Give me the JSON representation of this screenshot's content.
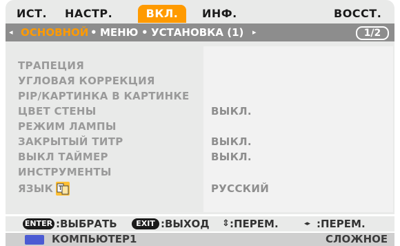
{
  "top_tabs": {
    "items": [
      {
        "label": "ИСТ."
      },
      {
        "label": "НАСТР."
      },
      {
        "label": "ВКЛ.",
        "active": true
      },
      {
        "label": "ИНФ."
      },
      {
        "label": "ВОССТ."
      }
    ]
  },
  "sub_tabs": {
    "items": [
      {
        "label": "ОСНОВНОЙ",
        "active": true
      },
      {
        "label": "МЕНЮ"
      },
      {
        "label": "УСТАНОВКА (1)"
      }
    ],
    "page_indicator": "1/2",
    "left_arrow": "◂",
    "right_arrow": "▸",
    "separator": "•"
  },
  "menu": {
    "rows": [
      {
        "label": "ТРАПЕЦИЯ",
        "value": ""
      },
      {
        "label": "УГЛОВАЯ КОРРЕКЦИЯ",
        "value": ""
      },
      {
        "label": "PIP/КАРТИНКА В КАРТИНКЕ",
        "value": ""
      },
      {
        "label": "ЦВЕТ СТЕНЫ",
        "value": "ВЫКЛ."
      },
      {
        "label": "РЕЖИМ ЛАМПЫ",
        "value": ""
      },
      {
        "label": "ЗАКРЫТЫЙ ТИТР",
        "value": "ВЫКЛ."
      },
      {
        "label": "ВЫКЛ ТАЙМЕР",
        "value": "ВЫКЛ."
      },
      {
        "label": "ИНСТРУМЕНТЫ",
        "value": ""
      },
      {
        "label": "ЯЗЫК",
        "value": "РУССКИЙ",
        "icon": "language-icon"
      }
    ]
  },
  "hints": {
    "enter_key": "ENTER",
    "enter_action": ":ВЫБРАТЬ",
    "exit_key": "EXIT",
    "exit_action": ":ВЫХОД",
    "updown_symbol": "⇕",
    "updown_action": ":ПЕРЕМ.",
    "leftright_symbol": "◂▸",
    "leftright_action": ":ПЕРЕМ."
  },
  "status": {
    "source_icon": "monitor-icon",
    "source": "КОМПЬЮТЕР1",
    "mode": "СЛОЖНОЕ"
  },
  "colors": {
    "accent": "#ff9a00",
    "panel": "#e9eae9",
    "subbar": "#8d8d8d"
  }
}
